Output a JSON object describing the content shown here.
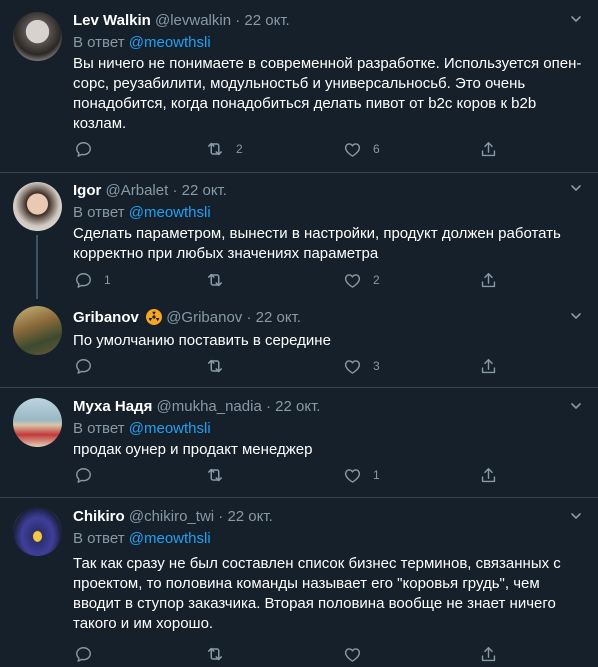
{
  "tweets": [
    {
      "name": "Lev Walkin",
      "handle": "@levwalkin",
      "date": "22 окт.",
      "reply_prefix": "В ответ",
      "reply_to": "@meowthsli",
      "text": "Вы ничего не понимаете в современной разработке. Используется опен-сорс, реузабилити, модульностьб и универсальносьб. Это очень понадобится, когда понадобиться делать пивот от b2c коров к b2b козлам.",
      "replies": "",
      "retweets": "2",
      "likes": "6"
    },
    {
      "name": "Igor",
      "handle": "@Arbalet",
      "date": "22 окт.",
      "reply_prefix": "В ответ",
      "reply_to": "@meowthsli",
      "text": "Сделать параметром, вынести в настройки, продукт должен работать корректно при любых значениях параметра",
      "replies": "1",
      "retweets": "",
      "likes": "2"
    },
    {
      "name": "Gribanov",
      "handle": "@Gribanov",
      "date": "22 окт.",
      "text": "По умолчанию поставить в середине",
      "replies": "",
      "retweets": "",
      "likes": "3"
    },
    {
      "name": "Муха Надя",
      "handle": "@mukha_nadia",
      "date": "22 окт.",
      "reply_prefix": "В ответ",
      "reply_to": "@meowthsli",
      "text": "продак оунер и продакт менеджер",
      "replies": "",
      "retweets": "",
      "likes": "1"
    },
    {
      "name": "Chikiro",
      "handle": "@chikiro_twi",
      "date": "22 окт.",
      "reply_prefix": "В ответ",
      "reply_to": "@meowthsli",
      "text": "Так как сразу не был составлен список бизнес терминов, связанных с проектом, то половина команды называет его \"коровья грудь\", чем вводит в ступор заказчика. Вторая половина вообще не знает ничего такого и им хорошо.",
      "replies": "",
      "retweets": "",
      "likes": ""
    }
  ],
  "separator": "·",
  "colors": {
    "background": "#15202b",
    "border": "#38444d",
    "secondary_text": "#8899a6",
    "link": "#1da1f2"
  },
  "icons": [
    "reply-icon",
    "retweet-icon",
    "like-icon",
    "share-icon",
    "caret-down-icon",
    "radioactive-icon"
  ]
}
